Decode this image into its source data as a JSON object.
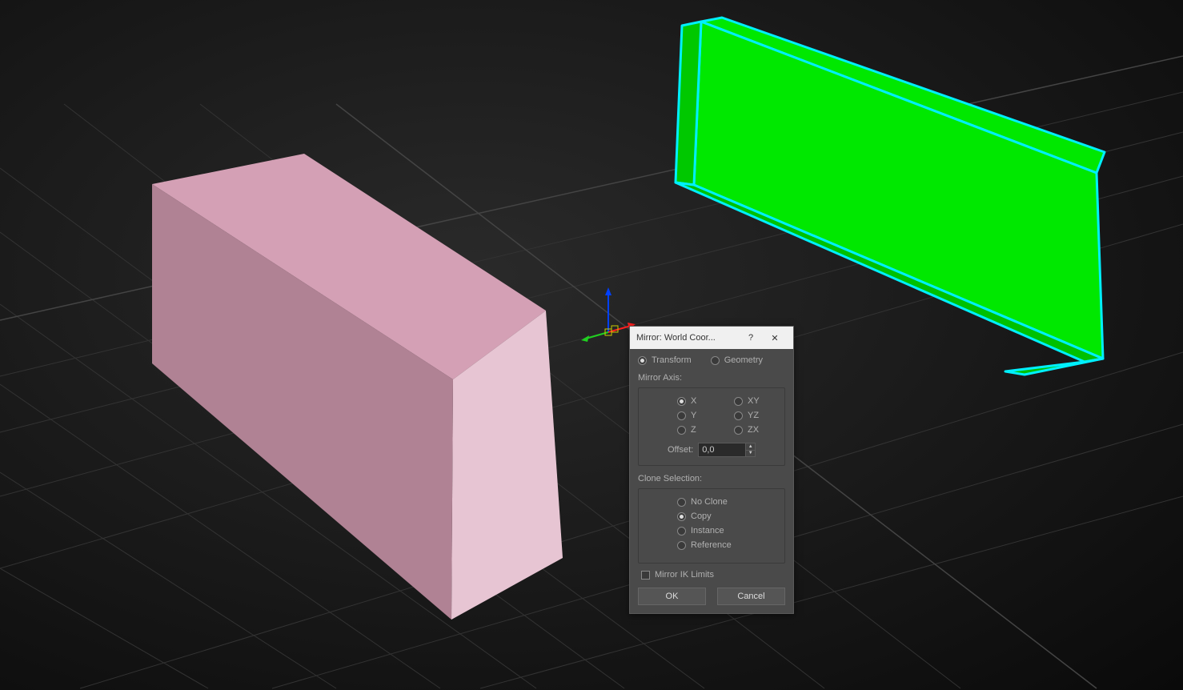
{
  "dialog": {
    "title": "Mirror: World Coor...",
    "help_icon": "?",
    "close_icon": "✕",
    "mode": {
      "transform": "Transform",
      "geometry": "Geometry",
      "selected": "transform"
    },
    "mirror_axis": {
      "label": "Mirror Axis:",
      "options": {
        "x": "X",
        "y": "Y",
        "z": "Z",
        "xy": "XY",
        "yz": "YZ",
        "zx": "ZX"
      },
      "selected": "x",
      "offset_label": "Offset:",
      "offset_value": "0,0"
    },
    "clone": {
      "label": "Clone Selection:",
      "options": {
        "no_clone": "No Clone",
        "copy": "Copy",
        "instance": "Instance",
        "reference": "Reference"
      },
      "selected": "copy"
    },
    "mirror_ik_limits": "Mirror IK Limits",
    "buttons": {
      "ok": "OK",
      "cancel": "Cancel"
    }
  }
}
